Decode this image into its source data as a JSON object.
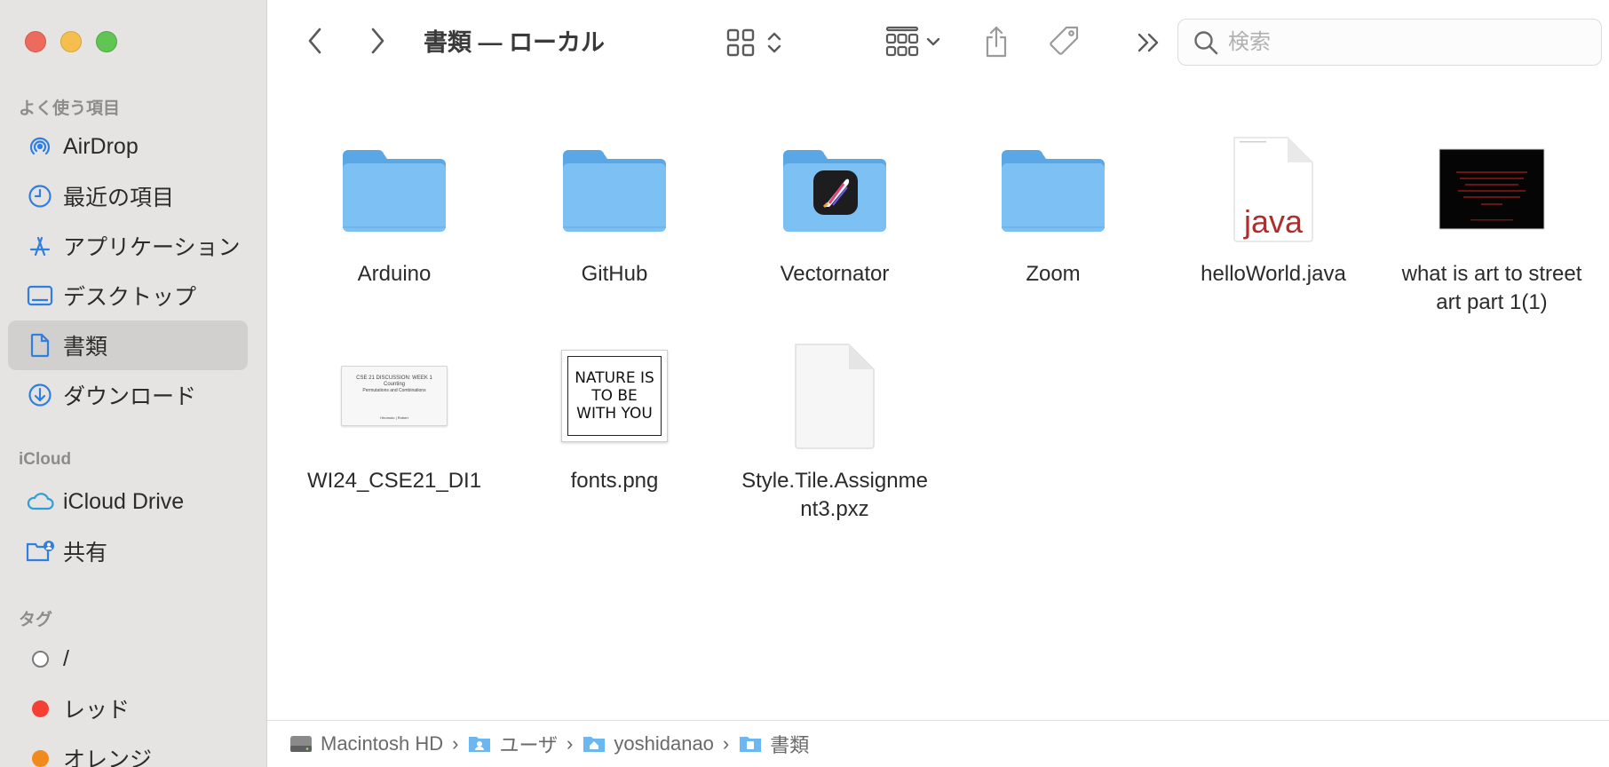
{
  "window": {
    "title": "書類 — ローカル"
  },
  "sidebar": {
    "favorites_title": "よく使う項目",
    "favorites": [
      {
        "label": "AirDrop",
        "icon": "airdrop-icon"
      },
      {
        "label": "最近の項目",
        "icon": "clock-icon"
      },
      {
        "label": "アプリケーション",
        "icon": "applications-icon"
      },
      {
        "label": "デスクトップ",
        "icon": "desktop-icon"
      },
      {
        "label": "書類",
        "icon": "document-icon",
        "selected": true
      },
      {
        "label": "ダウンロード",
        "icon": "download-icon"
      }
    ],
    "icloud_title": "iCloud",
    "icloud": [
      {
        "label": "iCloud Drive",
        "icon": "cloud-icon"
      },
      {
        "label": "共有",
        "icon": "shared-folder-icon"
      }
    ],
    "tags_title": "タグ",
    "tags": [
      {
        "label": "/",
        "color": "#ffffff"
      },
      {
        "label": "レッド",
        "color": "#f43f33"
      },
      {
        "label": "オレンジ",
        "color": "#f08a1c"
      }
    ]
  },
  "toolbar": {
    "search_placeholder": "検索"
  },
  "files": [
    {
      "name": "Arduino",
      "kind": "folder"
    },
    {
      "name": "GitHub",
      "kind": "folder"
    },
    {
      "name": "Vectornator",
      "kind": "app-folder"
    },
    {
      "name": "Zoom",
      "kind": "folder"
    },
    {
      "name": "helloWorld.java",
      "kind": "java",
      "badge": "java"
    },
    {
      "name": "what is art to street art part 1(1)",
      "kind": "dark-doc"
    },
    {
      "name": "WI24_CSE21_DI1",
      "kind": "slide",
      "slide_title": "CSE 21 DISCUSSION: WEEK 1",
      "slide_subtitle": "Counting",
      "slide_line3": "Permutations and Combinations",
      "slide_footer": "Hiromoto | Robert"
    },
    {
      "name": "fonts.png",
      "kind": "image",
      "image_text": "NATURE IS TO BE WITH YOU"
    },
    {
      "name": "Style.Tile.Assignment3.pxz",
      "kind": "blank-doc"
    }
  ],
  "pathbar": {
    "crumbs": [
      "Macintosh HD",
      "ユーザ",
      "yoshidanao",
      "書類"
    ]
  },
  "colors": {
    "folder_blue": "#7cc0f4",
    "folder_tab": "#5aa7e6",
    "sidebar_bg": "#e6e4e3",
    "java_red": "#b32c2c"
  }
}
